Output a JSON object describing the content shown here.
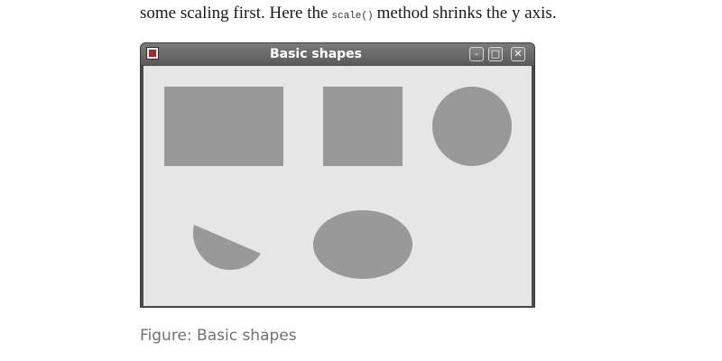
{
  "article": {
    "text_before_code": "some scaling first. Here the",
    "code": "scale()",
    "text_after_code": "method shrinks the y axis."
  },
  "window": {
    "title": "Basic shapes",
    "buttons": {
      "minimize_glyph": "–",
      "maximize_glyph": "□",
      "close_glyph": "✕"
    },
    "shape_fill": "#999999",
    "client_background": "#e6e6e6",
    "shapes": [
      "rectangle",
      "square",
      "circle",
      "pie-segment",
      "ellipse"
    ]
  },
  "figure": {
    "caption": "Figure: Basic shapes"
  }
}
